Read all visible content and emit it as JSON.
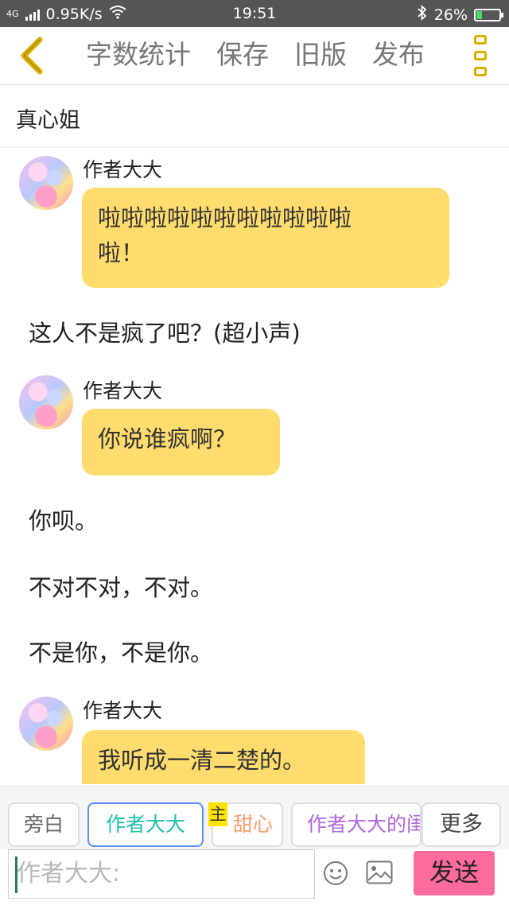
{
  "status_bar": {
    "network_label": "4G",
    "speed": "0.95K/s",
    "time": "19:51",
    "battery_percent": "26%",
    "battery_level": 0.26
  },
  "toolbar": {
    "items": [
      "字数统计",
      "保存",
      "旧版",
      "发布"
    ],
    "accent_color": "#d9b000"
  },
  "story_title": "真心姐",
  "messages": [
    {
      "type": "character",
      "author": "作者大大",
      "lines": [
        "啦啦啦啦啦啦啦啦啦啦啦",
        "啦！"
      ]
    },
    {
      "type": "narration",
      "text": "这人不是疯了吧？(超小声)"
    },
    {
      "type": "character",
      "author": "作者大大",
      "lines": [
        "你说谁疯啊？"
      ]
    },
    {
      "type": "narration",
      "text": "你呗。"
    },
    {
      "type": "narration",
      "text": "不对不对，不对。"
    },
    {
      "type": "narration",
      "text": "不是你，不是你。"
    },
    {
      "type": "character",
      "author": "作者大大",
      "lines": [
        "我听成一清二楚的。"
      ]
    }
  ],
  "role_bar": {
    "chips": [
      {
        "label": "旁白",
        "color": "#666666"
      },
      {
        "label": "作者大大",
        "color": "#1fbfae"
      },
      {
        "label": "甜心",
        "color": "#ff9a6a"
      },
      {
        "label": "作者大大的闺",
        "color": "#b266e0"
      }
    ],
    "main_tag": "主",
    "more_label": "更多"
  },
  "input": {
    "placeholder": "作者大大:",
    "send_label": "发送"
  },
  "colors": {
    "bubble": "#ffdc6e",
    "send_button": "#ff6b9a",
    "selected_chip_border": "#5b8ff0"
  }
}
